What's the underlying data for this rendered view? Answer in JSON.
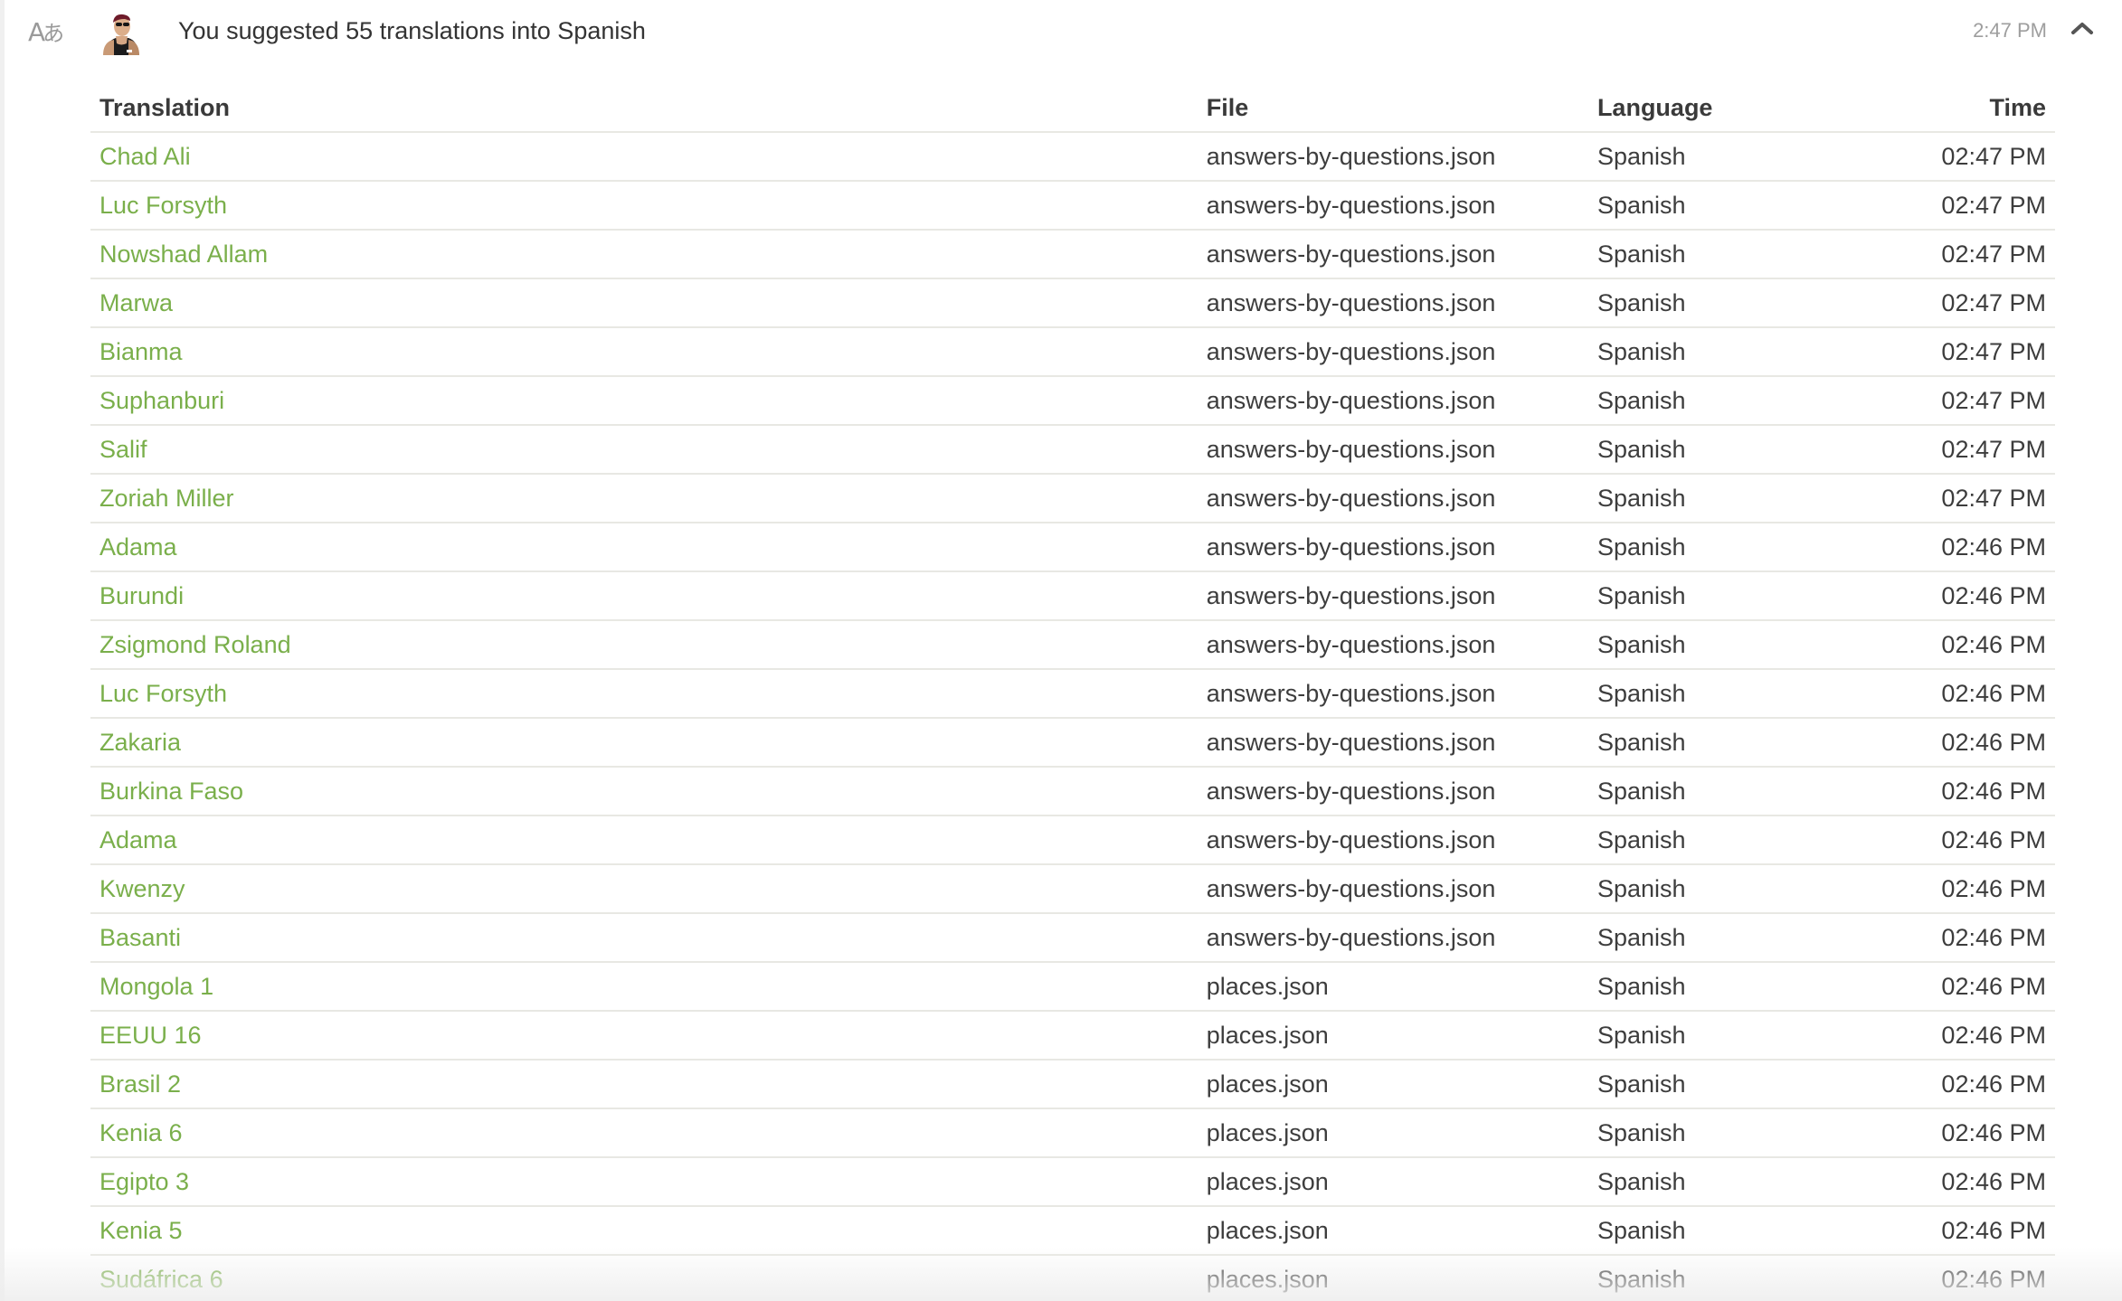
{
  "header": {
    "icon": "translate-icon",
    "icon_glyph_latin": "A",
    "icon_glyph_japanese": "あ",
    "avatar": "user-avatar",
    "title": "You suggested 55 translations into Spanish",
    "time": "2:47 PM",
    "collapse_icon": "chevron-up-icon"
  },
  "colors": {
    "link": "#7aaf4b",
    "text": "#3d3d3d",
    "muted": "#9e9e9e",
    "divider": "#e8e8e3"
  },
  "table": {
    "columns": [
      "Translation",
      "File",
      "Language",
      "Time"
    ],
    "rows": [
      {
        "translation": "Chad Ali",
        "file": "answers-by-questions.json",
        "language": "Spanish",
        "time": "02:47 PM"
      },
      {
        "translation": "Luc Forsyth",
        "file": "answers-by-questions.json",
        "language": "Spanish",
        "time": "02:47 PM"
      },
      {
        "translation": "Nowshad Allam",
        "file": "answers-by-questions.json",
        "language": "Spanish",
        "time": "02:47 PM"
      },
      {
        "translation": "Marwa",
        "file": "answers-by-questions.json",
        "language": "Spanish",
        "time": "02:47 PM"
      },
      {
        "translation": "Bianma",
        "file": "answers-by-questions.json",
        "language": "Spanish",
        "time": "02:47 PM"
      },
      {
        "translation": "Suphanburi",
        "file": "answers-by-questions.json",
        "language": "Spanish",
        "time": "02:47 PM"
      },
      {
        "translation": "Salif",
        "file": "answers-by-questions.json",
        "language": "Spanish",
        "time": "02:47 PM"
      },
      {
        "translation": "Zoriah Miller",
        "file": "answers-by-questions.json",
        "language": "Spanish",
        "time": "02:47 PM"
      },
      {
        "translation": "Adama",
        "file": "answers-by-questions.json",
        "language": "Spanish",
        "time": "02:46 PM"
      },
      {
        "translation": "Burundi",
        "file": "answers-by-questions.json",
        "language": "Spanish",
        "time": "02:46 PM"
      },
      {
        "translation": "Zsigmond Roland",
        "file": "answers-by-questions.json",
        "language": "Spanish",
        "time": "02:46 PM"
      },
      {
        "translation": "Luc Forsyth",
        "file": "answers-by-questions.json",
        "language": "Spanish",
        "time": "02:46 PM"
      },
      {
        "translation": "Zakaria",
        "file": "answers-by-questions.json",
        "language": "Spanish",
        "time": "02:46 PM"
      },
      {
        "translation": "Burkina Faso",
        "file": "answers-by-questions.json",
        "language": "Spanish",
        "time": "02:46 PM"
      },
      {
        "translation": "Adama",
        "file": "answers-by-questions.json",
        "language": "Spanish",
        "time": "02:46 PM"
      },
      {
        "translation": "Kwenzy",
        "file": "answers-by-questions.json",
        "language": "Spanish",
        "time": "02:46 PM"
      },
      {
        "translation": "Basanti",
        "file": "answers-by-questions.json",
        "language": "Spanish",
        "time": "02:46 PM"
      },
      {
        "translation": "Mongola 1",
        "file": "places.json",
        "language": "Spanish",
        "time": "02:46 PM"
      },
      {
        "translation": "EEUU 16",
        "file": "places.json",
        "language": "Spanish",
        "time": "02:46 PM"
      },
      {
        "translation": "Brasil 2",
        "file": "places.json",
        "language": "Spanish",
        "time": "02:46 PM"
      },
      {
        "translation": "Kenia 6",
        "file": "places.json",
        "language": "Spanish",
        "time": "02:46 PM"
      },
      {
        "translation": "Egipto 3",
        "file": "places.json",
        "language": "Spanish",
        "time": "02:46 PM"
      },
      {
        "translation": "Kenia 5",
        "file": "places.json",
        "language": "Spanish",
        "time": "02:46 PM"
      },
      {
        "translation": "Sudáfrica 6",
        "file": "places.json",
        "language": "Spanish",
        "time": "02:46 PM"
      }
    ]
  }
}
